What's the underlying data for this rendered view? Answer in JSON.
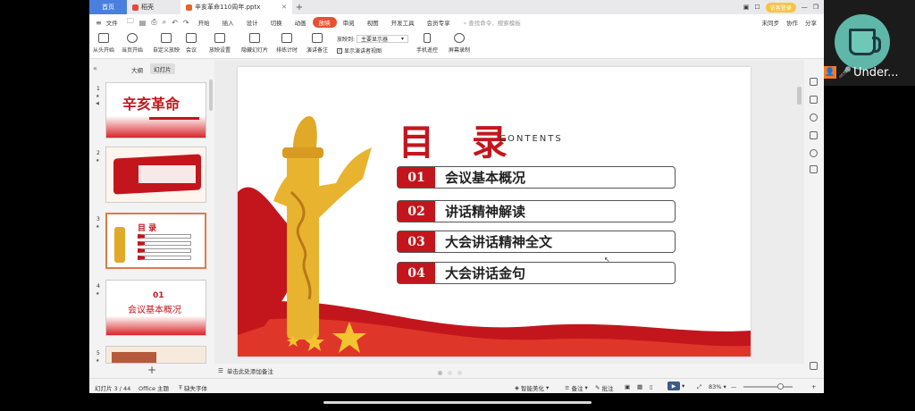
{
  "window": {
    "tabs": [
      {
        "label": "首页",
        "color": "#4a7fe0"
      },
      {
        "label": "稻壳",
        "color": "#e34a3a"
      },
      {
        "label": "辛亥革命110周年.pptx",
        "color": "#e8642c"
      }
    ],
    "new_tab": "+",
    "login_label": "访客登录"
  },
  "menu": {
    "file": "文件",
    "items": [
      "开始",
      "插入",
      "设计",
      "切换",
      "动画",
      "放映",
      "审阅",
      "视图",
      "开发工具",
      "会员专享"
    ],
    "active": "放映",
    "search_placeholder": "查找命令、搜索模板",
    "right": [
      "未同步",
      "协作",
      "分享"
    ]
  },
  "ribbon": {
    "buttons": [
      "从头开始",
      "当页开始",
      "自定义放映",
      "会议",
      "放映设置",
      "隐藏幻灯片",
      "排练计时",
      "演讲备注"
    ],
    "display_label": "放映到:",
    "display_value": "主要显示器",
    "presenter_view": "显示演讲者视图",
    "phone_remote": "手机遥控",
    "screen_record": "屏幕录制"
  },
  "left_pane": {
    "tab_outline": "大纲",
    "tab_slides": "幻灯片",
    "slide_numbers": [
      "1",
      "2",
      "3",
      "4",
      "5"
    ],
    "thumb1_title": "辛亥革命",
    "thumb4_num": "01",
    "thumb4_title": "会议基本概况",
    "add_slide": "+"
  },
  "slide": {
    "title": "目 录",
    "title_en": "CONTENTS",
    "items": [
      {
        "num": "01",
        "text": "会议基本概况"
      },
      {
        "num": "02",
        "text": "讲话精神解读"
      },
      {
        "num": "03",
        "text": "大会讲话精神全文"
      },
      {
        "num": "04",
        "text": "大会讲话金句"
      }
    ],
    "accent": "#c3161c"
  },
  "notes_placeholder": "单击此处添加备注",
  "status": {
    "slide_info": "幻灯片 3 / 44",
    "theme": "Office 主题",
    "missing_font": "缺失字体",
    "beautify": "智能美化",
    "notes": "备注",
    "comments": "批注",
    "zoom": "83%"
  },
  "meeting": {
    "name": "Under..."
  }
}
